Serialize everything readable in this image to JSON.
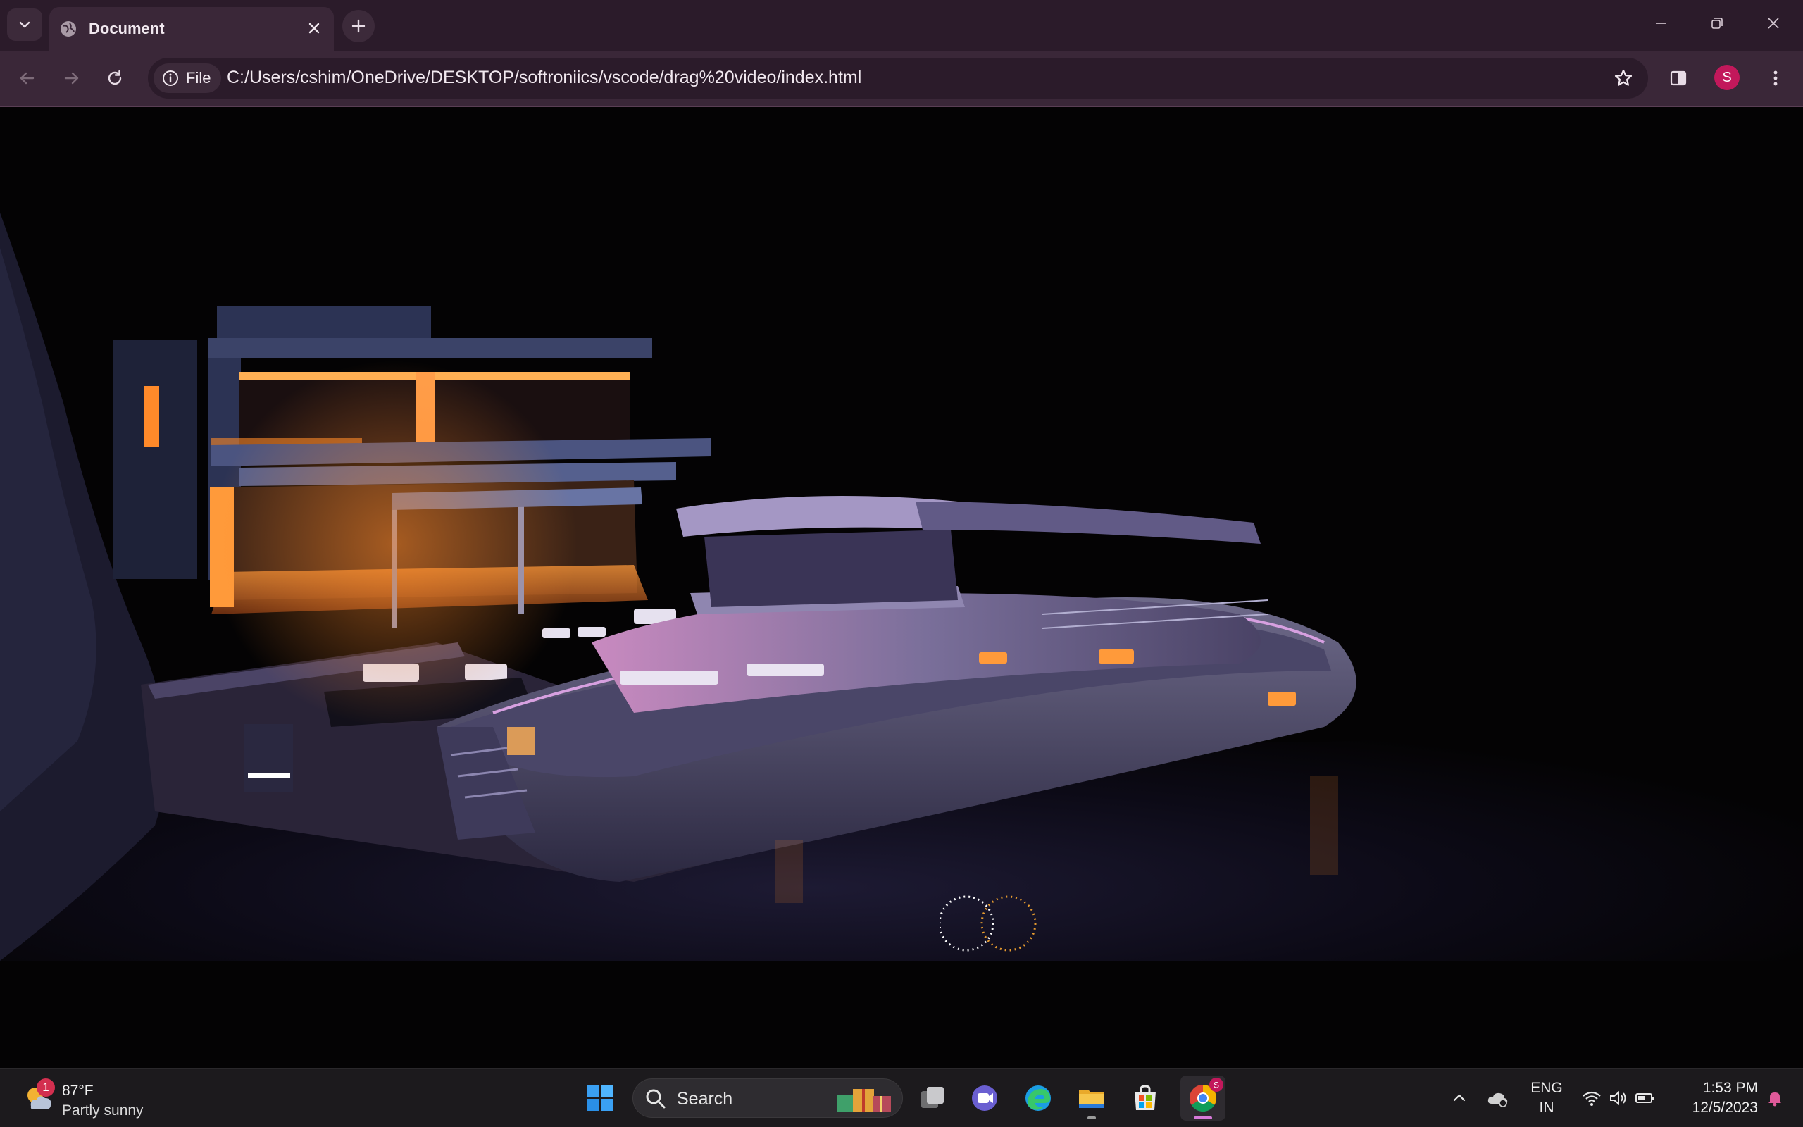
{
  "browser": {
    "tab": {
      "title": "Document"
    },
    "address_bar": {
      "security_chip": "File",
      "url": "C:/Users/cshim/OneDrive/DESKTOP/softroniics/vscode/drag%20video/index.html"
    },
    "profile_initial": "S"
  },
  "taskbar": {
    "weather": {
      "temperature": "87°F",
      "condition": "Partly sunny",
      "badge_count": "1"
    },
    "search": {
      "placeholder": "Search"
    },
    "apps": [
      "start",
      "search",
      "task-view",
      "teams",
      "edge",
      "file-explorer",
      "microsoft-store",
      "chrome"
    ],
    "language": {
      "line1": "ENG",
      "line2": "IN"
    },
    "clock": {
      "time": "1:53 PM",
      "date": "12/5/2023"
    }
  },
  "colors": {
    "chrome_dark": "#2b1b2a",
    "chrome_toolbar": "#3a2738",
    "warm_light": "#ff8a2a",
    "loader_white": "#ffffff",
    "loader_orange": "#e59a2f"
  }
}
